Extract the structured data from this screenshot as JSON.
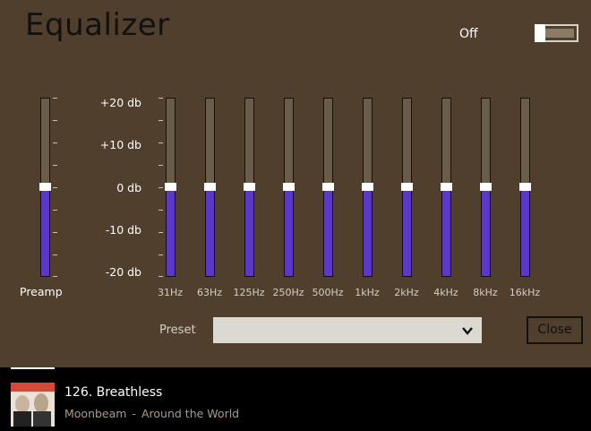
{
  "title": "Equalizer",
  "toggle": {
    "label": "Off",
    "on": false
  },
  "preamp": {
    "label": "Preamp",
    "value_db": 0
  },
  "db_scale": [
    "+20 db",
    "+10 db",
    "0 db",
    "-10 db",
    "-20 db"
  ],
  "bands": [
    {
      "label": "31Hz",
      "value_db": 0
    },
    {
      "label": "63Hz",
      "value_db": 0
    },
    {
      "label": "125Hz",
      "value_db": 0
    },
    {
      "label": "250Hz",
      "value_db": 0
    },
    {
      "label": "500Hz",
      "value_db": 0
    },
    {
      "label": "1kHz",
      "value_db": 0
    },
    {
      "label": "2kHz",
      "value_db": 0
    },
    {
      "label": "4kHz",
      "value_db": 0
    },
    {
      "label": "8kHz",
      "value_db": 0
    },
    {
      "label": "16kHz",
      "value_db": 0
    }
  ],
  "preset": {
    "label": "Preset",
    "value": ""
  },
  "close_label": "Close",
  "now_playing": {
    "title": "126. Breathless",
    "artist": "Moonbeam",
    "separator": "-",
    "album": "Around the World"
  },
  "colors": {
    "background": "#4f3f2c",
    "slider_fill": "#5a38c8",
    "slider_track": "#6a5c4b",
    "now_playing_bg": "#000000"
  },
  "icons": {
    "preset_dropdown": "chevron-down-icon"
  }
}
